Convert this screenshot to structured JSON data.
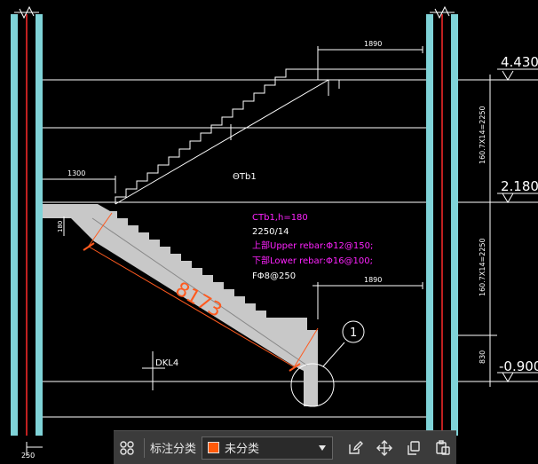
{
  "drawing": {
    "elevations": {
      "top": "4.430",
      "middle": "2.180",
      "bottom": "-0.900"
    },
    "dimensions": {
      "top_landing": "1890",
      "mid_landing": "1300",
      "lower_landing": "1890",
      "run_length": "8173",
      "flight_upper": "160.7X14=2250",
      "flight_lower": "160.7X14=2250",
      "base_height": "830",
      "slab_thickness": "180",
      "column_width": "250"
    },
    "annotation": {
      "header": "CTb1,h=180",
      "steps": "2250/14",
      "upper_rebar": "上部Upper rebar:Φ12@150;",
      "lower_rebar": "下部Lower rebar:Φ16@100;",
      "distribution": "FΦ8@250"
    },
    "labels": {
      "stair_tag": "ΘTb1",
      "beam_tag": "DKL4",
      "callout": "1"
    },
    "colors": {
      "wall_fill": "#7fd3d8",
      "axis_red": "#ff2a2a",
      "stair_fill": "#c8c8c8",
      "annotation_magenta": "#ff22ff",
      "dimension_orange": "#ff5a1f",
      "line_white": "#ffffff"
    }
  },
  "toolbar": {
    "label": "标注分类",
    "category_value": "未分类",
    "category_color": "#ff5a0a"
  }
}
